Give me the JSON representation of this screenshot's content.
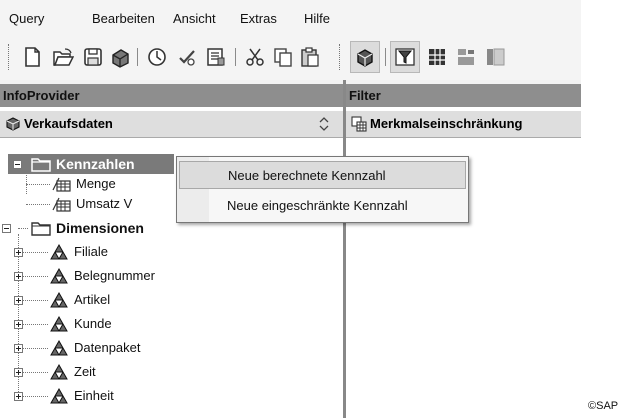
{
  "menubar": {
    "items": [
      "Query",
      "Bearbeiten",
      "Ansicht",
      "Extras",
      "Hilfe"
    ]
  },
  "toolbar": {
    "icons": [
      "new-icon",
      "open-icon",
      "save-icon",
      "save-all-icon",
      "query-icon",
      "check-icon",
      "properties-icon",
      "cut-icon",
      "copy-icon",
      "paste-icon",
      "infoprovider-icon",
      "filter-icon",
      "rows-columns-icon",
      "conditions-icon"
    ]
  },
  "left_pane": {
    "title": "InfoProvider",
    "provider": "Verkaufsdaten",
    "tree": {
      "kennzahlen": {
        "label": "Kennzahlen",
        "children": [
          "Menge",
          "Umsatz V"
        ]
      },
      "dimensionen": {
        "label": "Dimensionen",
        "children": [
          "Filiale",
          "Belegnummer",
          "Artikel",
          "Kunde",
          "Datenpaket",
          "Zeit",
          "Einheit"
        ]
      }
    }
  },
  "right_pane": {
    "title": "Filter",
    "subheader": "Merkmalseinschränkung"
  },
  "context_menu": {
    "items": [
      {
        "label": "Neue berechnete Kennzahl",
        "active": true
      },
      {
        "label": "Neue eingeschränkte Kennzahl",
        "active": false
      }
    ]
  },
  "copyright": "©SAP"
}
